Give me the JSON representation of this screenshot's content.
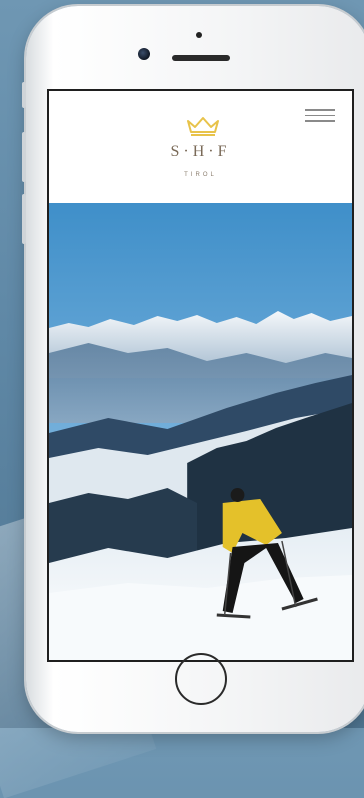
{
  "logo": {
    "name": "S·H·F",
    "sub": "TIROL",
    "icon": "crown-icon",
    "accent": "#e8c34a"
  },
  "header": {
    "menu_icon": "hamburger-menu-icon"
  },
  "hero": {
    "description": "skier-on-snowy-mountain-slope"
  },
  "device": {
    "home_button_icon": "home-button-icon"
  }
}
